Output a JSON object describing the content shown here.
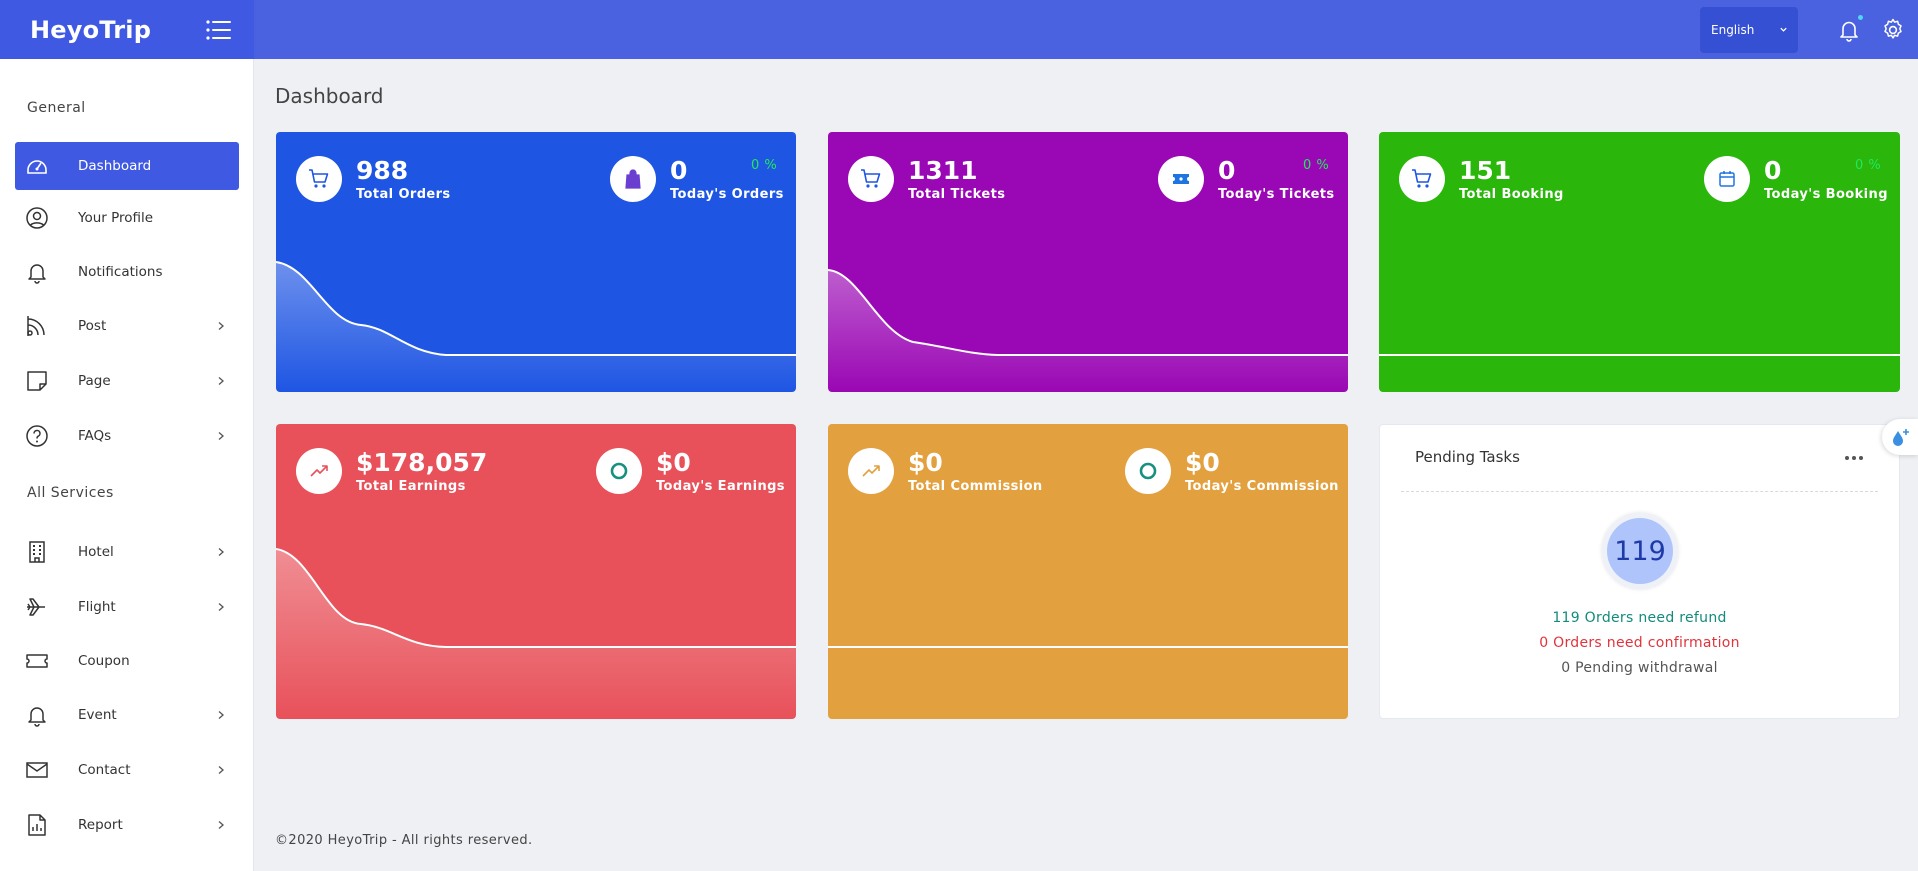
{
  "app": {
    "brand": "HeyoTrip"
  },
  "header": {
    "language": "English"
  },
  "sidebar": {
    "general_title": "General",
    "services_title": "All Services",
    "items": [
      {
        "label": "Dashboard",
        "icon": "dashboard-icon"
      },
      {
        "label": "Your Profile",
        "icon": "user-icon"
      },
      {
        "label": "Notifications",
        "icon": "bell-icon"
      },
      {
        "label": "Post",
        "icon": "rss-icon"
      },
      {
        "label": "Page",
        "icon": "note-icon"
      },
      {
        "label": "FAQs",
        "icon": "question-icon"
      },
      {
        "label": "Hotel",
        "icon": "building-icon"
      },
      {
        "label": "Flight",
        "icon": "plane-icon"
      },
      {
        "label": "Coupon",
        "icon": "ticket-icon"
      },
      {
        "label": "Event",
        "icon": "bell-icon"
      },
      {
        "label": "Contact",
        "icon": "mail-icon"
      },
      {
        "label": "Report",
        "icon": "report-icon"
      }
    ]
  },
  "main": {
    "title": "Dashboard",
    "cards": [
      {
        "total_value": "988",
        "total_label": "Total Orders",
        "today_value": "0",
        "today_label": "Today's Orders",
        "percent": "0 %",
        "color": "#1e55e3"
      },
      {
        "total_value": "1311",
        "total_label": "Total Tickets",
        "today_value": "0",
        "today_label": "Today's Tickets",
        "percent": "0 %",
        "color": "#9a07b4"
      },
      {
        "total_value": "151",
        "total_label": "Total Booking",
        "today_value": "0",
        "today_label": "Today's Booking",
        "percent": "0 %",
        "color": "#2ab60b"
      },
      {
        "total_value": "$178,057",
        "total_label": "Total Earnings",
        "today_value": "$0",
        "today_label": "Today's Earnings",
        "color": "#e8515a"
      },
      {
        "total_value": "$0",
        "total_label": "Total Commission",
        "today_value": "$0",
        "today_label": "Today's Commission",
        "color": "#e3a03f"
      }
    ],
    "pending": {
      "title": "Pending Tasks",
      "count": "119",
      "refund": "119 Orders need refund",
      "confirmation": "0 Orders need confirmation",
      "withdrawal": "0 Pending withdrawal",
      "refund_color": "#138a7c",
      "confirmation_color": "#e0343c"
    }
  },
  "footer": {
    "text": "©2020 HeyoTrip - All rights reserved."
  }
}
